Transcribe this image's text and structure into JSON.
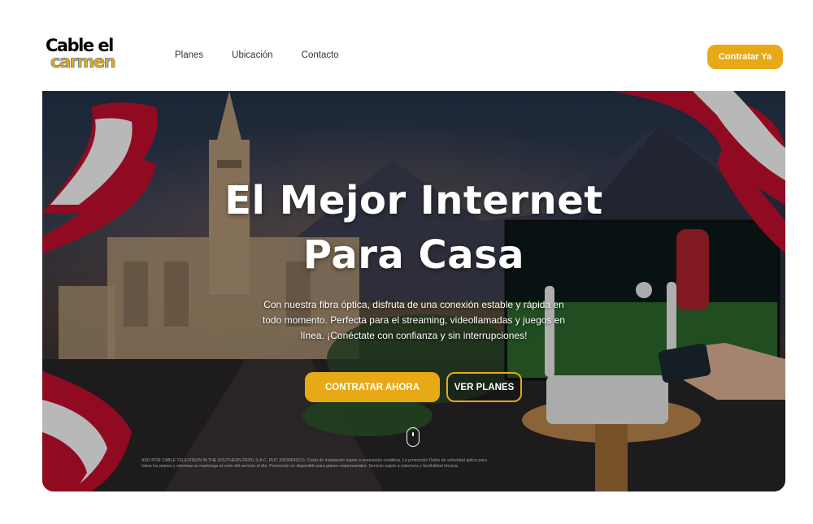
{
  "header": {
    "logo_line1": "Cable el",
    "logo_line2": "carmen",
    "nav": [
      "Planes",
      "Ubicación",
      "Contacto"
    ],
    "cta_label": "Contratar Ya"
  },
  "hero": {
    "title_line1": "El Mejor Internet",
    "title_line2": "Para Casa",
    "description": "Con nuestra fibra óptica, disfruta de una conexión estable y rápida en todo momento. Perfecta para el streaming, videollamadas y juegos en línea. ¡Conéctate con confianza y sin interrupciones!",
    "primary_button": "CONTRATAR AHORA",
    "secondary_button": "VER PLANES",
    "fineprint": "ASO POR CABLE TELEVISION IN THE SOUTHERN PERU S.A.C. RUC 20539043110. Costo de instalación sujeto a evaluación crediticia. La promoción Doble de velocidad aplica para todos los planes y mientras se mantenga al corte del servicio al día. Promoción no disponible para planes empresariales. Servicio sujeto a cobertura y factibilidad técnica."
  },
  "colors": {
    "accent": "#e8a916",
    "logo_blue": "#1f6fb5",
    "flag_red": "#c8102e"
  },
  "icons": [
    "mouse-scroll-icon",
    "router-icon",
    "peru-flag-ribbon"
  ]
}
